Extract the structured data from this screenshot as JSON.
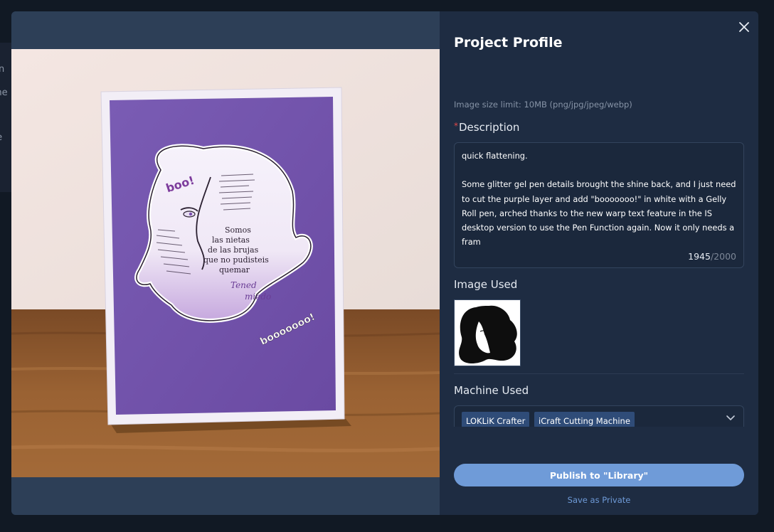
{
  "background": {
    "sidebar_items": [
      "en",
      "me",
      "t",
      "te"
    ]
  },
  "modal": {
    "title": "Project Profile",
    "close_icon": "close-icon",
    "image_limit": "Image size limit: 10MB (png/jpg/jpeg/webp)",
    "description": {
      "required_mark": "*",
      "label": "Description",
      "text": "quick flattening.\n\nSome glitter gel pen details brought the shine back, and I just need to cut the purple layer and add \"booooooo!\" in white with a Gelly Roll pen, arched thanks to the new warp text feature in the IS desktop version to use the Pen Function again. Now it only needs a fram",
      "count": "1945",
      "max": "/2000"
    },
    "image_used": {
      "label": "Image Used"
    },
    "machine_used": {
      "label": "Machine Used",
      "tags": [
        "LOKLiK Crafter",
        "iCraft Cutting Machine"
      ],
      "dropdown_icon": "chevron-down-icon"
    },
    "publish_label": "Publish to \"Library\"",
    "save_private_label": "Save as Private",
    "colors": {
      "accent": "#6f9bd8",
      "panel_bg": "#1e2c42",
      "tag_bg": "#2f4c78",
      "required": "#e04848"
    }
  },
  "photo": {
    "sticker_text": {
      "boo": "boo!",
      "somos": "Somos",
      "line2": "las nietas",
      "line3": "de las brujas",
      "line4": "que no pudisteis",
      "line5": "quemar",
      "tened": "Tened",
      "miedo": "miedo",
      "booooo": "booooooo!"
    }
  }
}
